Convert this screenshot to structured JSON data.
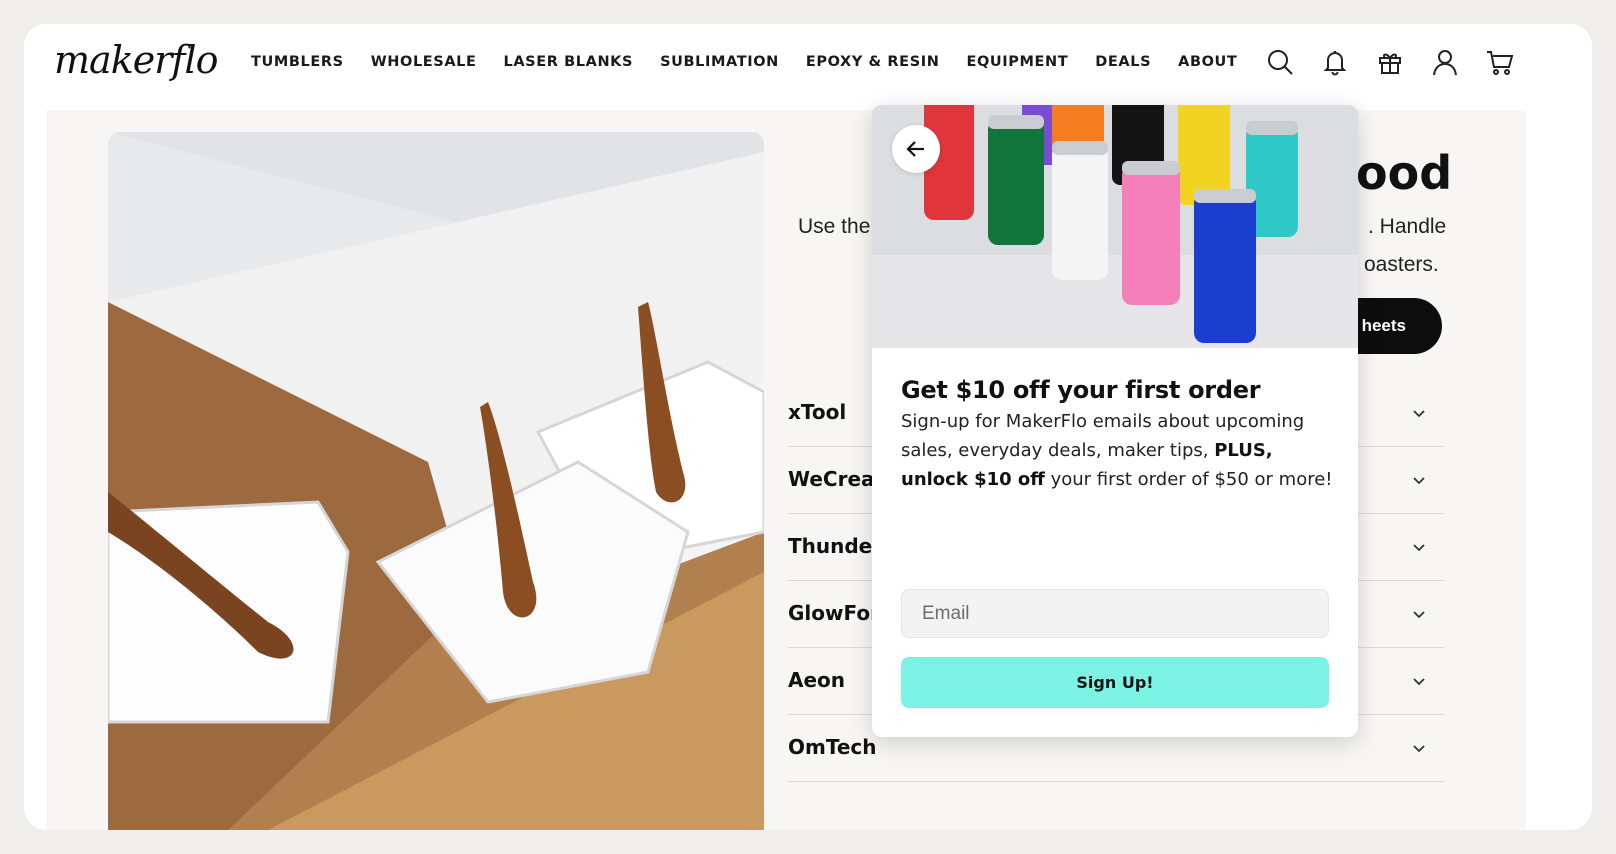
{
  "brand": {
    "logo_text": "makerflo"
  },
  "nav": {
    "items": [
      {
        "label": "TUMBLERS"
      },
      {
        "label": "WHOLESALE"
      },
      {
        "label": "LASER BLANKS"
      },
      {
        "label": "SUBLIMATION"
      },
      {
        "label": "EPOXY & RESIN"
      },
      {
        "label": "EQUIPMENT"
      },
      {
        "label": "DEALS"
      },
      {
        "label": "ABOUT"
      }
    ]
  },
  "header_icons": [
    "search-icon",
    "bell-icon",
    "gift-icon",
    "account-icon",
    "cart-icon"
  ],
  "section": {
    "title_fragment": "ood",
    "desc_line1_left": "Use the",
    "desc_line1_right": ". Handle",
    "desc_line2_right": "oasters.",
    "cta_fragment": "heets"
  },
  "accordion": [
    {
      "label": "xTool"
    },
    {
      "label": "WeCrea"
    },
    {
      "label": "Thunde"
    },
    {
      "label": "GlowFor"
    },
    {
      "label": "Aeon"
    },
    {
      "label": "OmTech"
    }
  ],
  "popup": {
    "title": "Get $10 off your first order",
    "body_intro": "Sign-up for MakerFlo emails about upcoming sales, everyday deals, maker tips, ",
    "body_bold": "PLUS, unlock $10 off",
    "body_end": " your first order of $50 or more!",
    "email_placeholder": "Email",
    "email_value": "",
    "signup_label": "Sign Up!"
  },
  "colors": {
    "accent": "#7bf2e4",
    "page_bg": "#f7f6f4",
    "text": "#111111"
  }
}
